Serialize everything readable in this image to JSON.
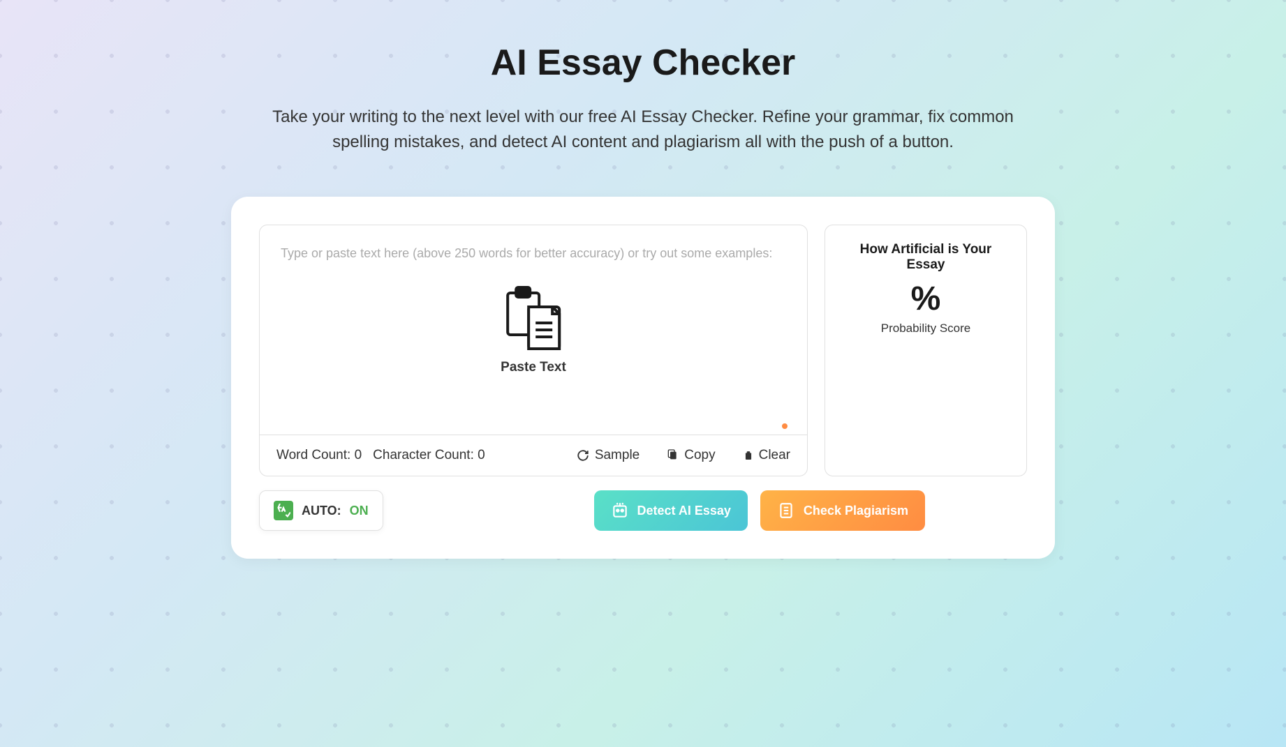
{
  "header": {
    "title": "AI Essay Checker",
    "subtitle": "Take your writing to the next level with our free AI Essay Checker. Refine your grammar, fix common spelling mistakes, and detect AI content and plagiarism all with the push of a button."
  },
  "editor": {
    "placeholder": "Type or paste text here (above 250 words for better accuracy) or try out some examples:",
    "paste_label": "Paste Text",
    "word_count_label": "Word Count:",
    "word_count_value": "0",
    "char_count_label": "Character Count:",
    "char_count_value": "0"
  },
  "footer_actions": {
    "sample": "Sample",
    "copy": "Copy",
    "clear": "Clear"
  },
  "results": {
    "title": "How Artificial is Your Essay",
    "percent": "%",
    "probability_label": "Probability Score"
  },
  "auto_toggle": {
    "label": "AUTO:",
    "status": "ON"
  },
  "buttons": {
    "detect": "Detect AI Essay",
    "plagiarism": "Check Plagiarism"
  }
}
